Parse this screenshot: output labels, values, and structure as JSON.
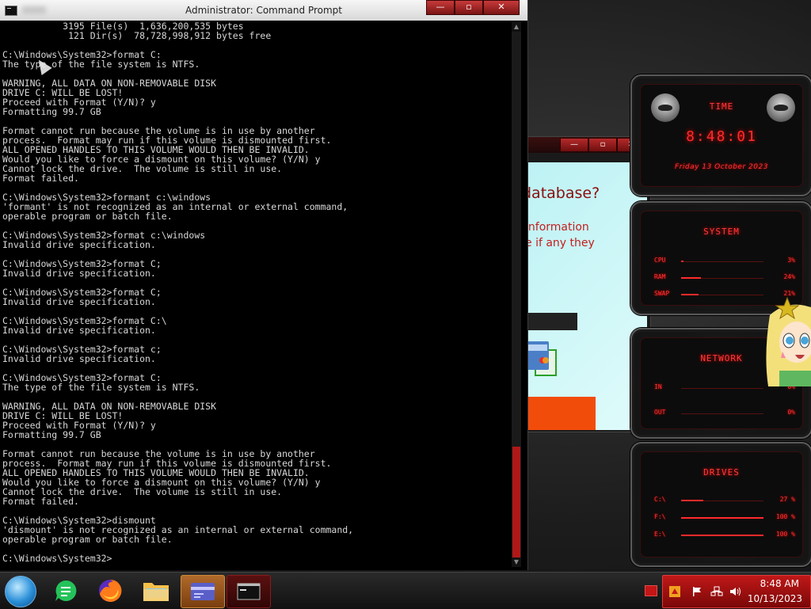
{
  "cmd": {
    "title": "Administrator: Command Prompt",
    "buttons": {
      "minimize": "—",
      "maximize": "▫",
      "close": "✕"
    },
    "lines": [
      "           3195 File(s)  1,636,200,535 bytes",
      "            121 Dir(s)  78,728,998,912 bytes free",
      "",
      "C:\\Windows\\System32>format C:",
      "The type of the file system is NTFS.",
      "",
      "WARNING, ALL DATA ON NON-REMOVABLE DISK",
      "DRIVE C: WILL BE LOST!",
      "Proceed with Format (Y/N)? y",
      "Formatting 99.7 GB",
      "",
      "Format cannot run because the volume is in use by another",
      "process.  Format may run if this volume is dismounted first.",
      "ALL OPENED HANDLES TO THIS VOLUME WOULD THEN BE INVALID.",
      "Would you like to force a dismount on this volume? (Y/N) y",
      "Cannot lock the drive.  The volume is still in use.",
      "Format failed.",
      "",
      "C:\\Windows\\System32>formant c:\\windows",
      "'formant' is not recognized as an internal or external command,",
      "operable program or batch file.",
      "",
      "C:\\Windows\\System32>format c:\\windows",
      "Invalid drive specification.",
      "",
      "C:\\Windows\\System32>format C;",
      "Invalid drive specification.",
      "",
      "C:\\Windows\\System32>format C;",
      "Invalid drive specification.",
      "",
      "C:\\Windows\\System32>format C:\\",
      "Invalid drive specification.",
      "",
      "C:\\Windows\\System32>format c;",
      "Invalid drive specification.",
      "",
      "C:\\Windows\\System32>format C:",
      "The type of the file system is NTFS.",
      "",
      "WARNING, ALL DATA ON NON-REMOVABLE DISK",
      "DRIVE C: WILL BE LOST!",
      "Proceed with Format (Y/N)? y",
      "Formatting 99.7 GB",
      "",
      "Format cannot run because the volume is in use by another",
      "process.  Format may run if this volume is dismounted first.",
      "ALL OPENED HANDLES TO THIS VOLUME WOULD THEN BE INVALID.",
      "Would you like to force a dismount on this volume? (Y/N) y",
      "Cannot lock the drive.  The volume is still in use.",
      "Format failed.",
      "",
      "C:\\Windows\\System32>dismount",
      "'dismount' is not recognized as an internal or external command,",
      "operable program or batch file.",
      "",
      "C:\\Windows\\System32>"
    ]
  },
  "dialog": {
    "buttons": {
      "minimize": "—",
      "maximize": "▫",
      "close": "✕"
    },
    "heading": "database?",
    "line1": "information",
    "line2": "e if any they"
  },
  "gadgets": {
    "time": {
      "title": "TIME",
      "clock": "8:48:01",
      "date": "Friday 13 October 2023"
    },
    "system": {
      "title": "SYSTEM",
      "stats": [
        {
          "label": "CPU",
          "value": "3%",
          "fraction": 0.03
        },
        {
          "label": "RAM",
          "value": "24%",
          "fraction": 0.24
        },
        {
          "label": "SWAP",
          "value": "21%",
          "fraction": 0.21
        }
      ]
    },
    "network": {
      "title": "NETWORK",
      "stats": [
        {
          "label": "IN",
          "value": "0%"
        },
        {
          "label": "OUT",
          "value": "0%"
        }
      ]
    },
    "drives": {
      "title": "DRIVES",
      "stats": [
        {
          "label": "C:\\",
          "value": "27 %",
          "fraction": 0.27
        },
        {
          "label": "F:\\",
          "value": "100 %",
          "fraction": 1.0
        },
        {
          "label": "E:\\",
          "value": "100 %",
          "fraction": 1.0
        }
      ]
    }
  },
  "taskbar": {
    "tray": {
      "time": "8:48 AM",
      "date": "10/13/2023"
    }
  },
  "colors": {
    "accent": "#ff2b2b",
    "taskbar_active": "#b06a2a",
    "tray": "#c01818"
  }
}
